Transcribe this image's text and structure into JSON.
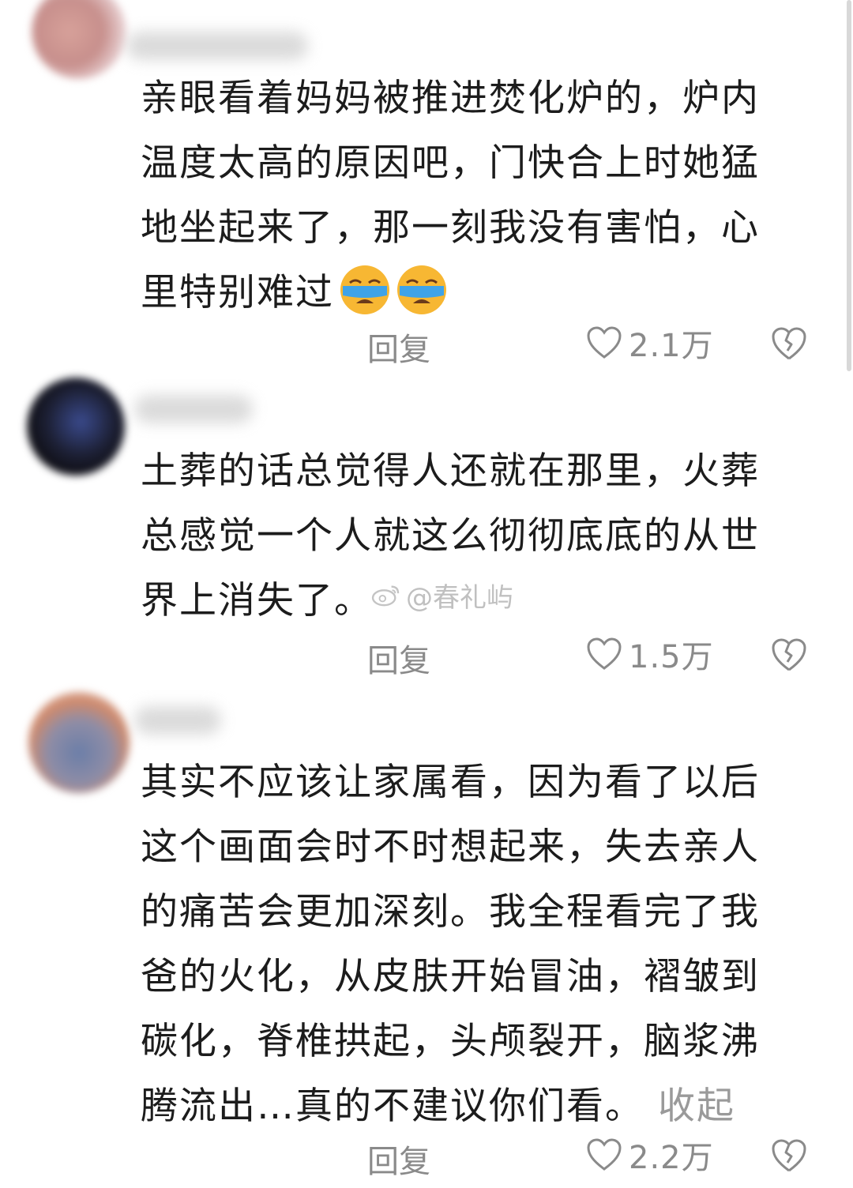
{
  "comments": [
    {
      "text": "亲眼看着妈妈被推进焚化炉的，炉内温度太高的原因吧，门快合上时她猛地坐起来了，那一刻我没有害怕，心里特别难过",
      "emoji": [
        "crying-face",
        "crying-face"
      ],
      "reply_label": "回复",
      "like_count": "2.1万"
    },
    {
      "text": "土葬的话总觉得人还就在那里，火葬总感觉一个人就这么彻彻底底的从世界上消失了。",
      "reply_label": "回复",
      "like_count": "1.5万"
    },
    {
      "text": "其实不应该让家属看，因为看了以后这个画面会时不时想起来，失去亲人的痛苦会更加深刻。我全程看完了我爸的火化，从皮肤开始冒油，褶皱到碳化，脊椎拱起，头颅裂开，脑浆沸腾流出…真的不建议你们看。",
      "collapse_label": "收起",
      "reply_label": "回复",
      "like_count": "2.2万"
    }
  ],
  "watermark": {
    "text": "@春礼屿"
  },
  "colors": {
    "text": "#1c1c1c",
    "meta": "#8a8a8a",
    "emoji": "#f7b733"
  }
}
